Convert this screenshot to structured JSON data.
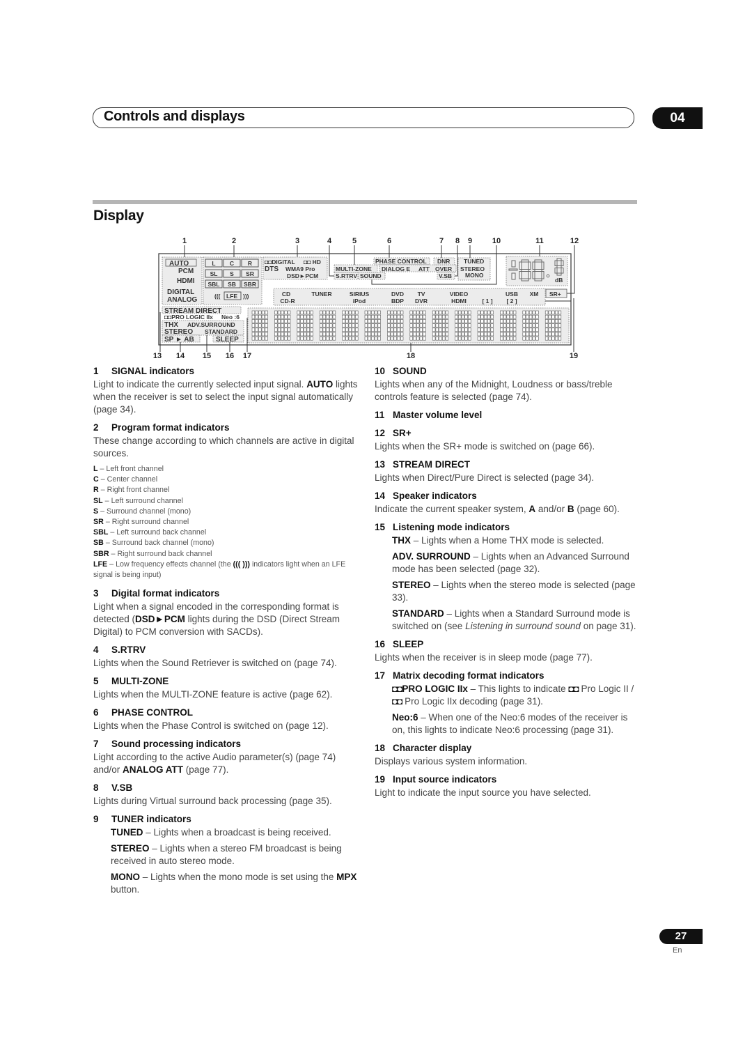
{
  "header": {
    "chapter_title": "Controls and displays",
    "chapter_number": "04"
  },
  "section": {
    "title": "Display"
  },
  "diagram": {
    "callouts_top": [
      "1",
      "2",
      "3",
      "4",
      "5",
      "6",
      "7",
      "8",
      "9",
      "10",
      "11",
      "12"
    ],
    "callouts_bottom": [
      "13",
      "14",
      "15",
      "16",
      "17",
      "18",
      "19"
    ],
    "signal": {
      "auto": "AUTO",
      "pcm": "PCM",
      "hdmi": "HDMI",
      "digital": "DIGITAL",
      "analog": "ANALOG"
    },
    "channels": [
      "L",
      "C",
      "R",
      "SL",
      "S",
      "SR",
      "SBL",
      "SB",
      "SBR"
    ],
    "lfe": {
      "left": "(((",
      "label": "LFE",
      "right": ")))"
    },
    "digital_format": {
      "dd_digital": "DIGITAL",
      "dd_hd": "HD",
      "dts": "DTS",
      "wma": "WMA9 Pro",
      "dsd": "DSD",
      "pcm": "PCM"
    },
    "multi_zone": "MULTI-ZONE",
    "s_rtrv": "S.RTRV",
    "sound": "SOUND",
    "phase_control": "PHASE CONTROL",
    "dialog_e": "DIALOG E",
    "att": "ATT",
    "over": "OVER",
    "dnr": "DNR",
    "vsb": "V.SB",
    "tuner": {
      "tuned": "TUNED",
      "stereo": "STEREO",
      "mono": "MONO"
    },
    "volume_unit": "dB",
    "inputs_row1": [
      "CD",
      "TUNER",
      "SIRIUS",
      "DVD",
      "TV",
      "VIDEO",
      "USB",
      "XM"
    ],
    "inputs_row2": [
      "CD-R",
      "iPod",
      "BDP",
      "DVR",
      "HDMI",
      "[ 1 ]",
      "[ 2 ]"
    ],
    "sr_plus": "SR+",
    "stream_direct": "STREAM DIRECT",
    "pro_logic": "PRO LOGIC",
    "pro_logic_suffix": "IIx",
    "neo": "Neo :6",
    "thx": "THX",
    "adv_surround": "ADV.SURROUND",
    "stereo": "STEREO",
    "standard": "STANDARD",
    "speaker": "SP ► AB",
    "sleep": "SLEEP",
    "character_cells": 14
  },
  "left_column": [
    {
      "num": "1",
      "title": "SIGNAL indicators",
      "body": [
        {
          "text": "Light to indicate the currently selected input signal. "
        },
        {
          "bold": "AUTO"
        },
        {
          "text": " lights when the receiver is set to select the input signal automatically (page 34)."
        }
      ]
    },
    {
      "num": "2",
      "title": "Program format indicators",
      "body": [
        {
          "text": "These change according to which channels are active in digital sources."
        }
      ],
      "legend": [
        {
          "key": "L",
          "desc": "Left front channel"
        },
        {
          "key": "C",
          "desc": "Center channel"
        },
        {
          "key": "R",
          "desc": "Right front channel"
        },
        {
          "key": "SL",
          "desc": "Left surround channel"
        },
        {
          "key": "S",
          "desc": "Surround channel (mono)"
        },
        {
          "key": "SR",
          "desc": "Right surround channel"
        },
        {
          "key": "SBL",
          "desc": "Left surround back channel"
        },
        {
          "key": "SB",
          "desc": "Surround back channel (mono)"
        },
        {
          "key": "SBR",
          "desc": "Right surround back channel"
        },
        {
          "key": "LFE",
          "desc": "Low frequency effects channel (the",
          "mid": "(((   )))",
          "tail": "indicators light when an LFE signal is being input)"
        }
      ]
    },
    {
      "num": "3",
      "title": "Digital format indicators",
      "body": [
        {
          "text": "Light when a signal encoded in the corresponding format is detected ("
        },
        {
          "bold": "DSD►PCM"
        },
        {
          "text": " lights during the DSD (Direct Stream Digital) to PCM conversion with SACDs)."
        }
      ]
    },
    {
      "num": "4",
      "title": "S.RTRV",
      "body": [
        {
          "text": "Lights when the Sound Retriever is switched on (page 74)."
        }
      ]
    },
    {
      "num": "5",
      "title": "MULTI-ZONE",
      "body": [
        {
          "text": "Lights when the MULTI-ZONE feature is active (page 62)."
        }
      ]
    },
    {
      "num": "6",
      "title": "PHASE CONTROL",
      "body": [
        {
          "text": "Lights when the Phase Control is switched on (page 12)."
        }
      ]
    },
    {
      "num": "7",
      "title": "Sound processing indicators",
      "body": [
        {
          "text": "Light according to the active Audio parameter(s) (page 74) and/or "
        },
        {
          "bold": "ANALOG ATT"
        },
        {
          "text": " (page 77)."
        }
      ]
    },
    {
      "num": "8",
      "title": "V.SB",
      "body": [
        {
          "text": "Lights during Virtual surround back processing (page 35)."
        }
      ]
    },
    {
      "num": "9",
      "title": "TUNER indicators",
      "subs": [
        [
          {
            "bold": "TUNED"
          },
          {
            "text": " – Lights when a broadcast is being received."
          }
        ],
        [
          {
            "bold": "STEREO"
          },
          {
            "text": " – Lights when a stereo FM broadcast is being received in auto stereo mode."
          }
        ],
        [
          {
            "bold": "MONO"
          },
          {
            "text": " – Lights when the mono mode is set using the "
          },
          {
            "bold": "MPX"
          },
          {
            "text": " button."
          }
        ]
      ]
    }
  ],
  "right_column": [
    {
      "num": "10",
      "title": "SOUND",
      "body": [
        {
          "text": "Lights when any of the Midnight, Loudness or bass/treble controls feature is selected (page 74)."
        }
      ]
    },
    {
      "num": "11",
      "title": "Master volume level",
      "body": []
    },
    {
      "num": "12",
      "title": "SR+",
      "body": [
        {
          "text": "Lights when the SR+ mode is switched on (page 66)."
        }
      ]
    },
    {
      "num": "13",
      "title": "STREAM DIRECT",
      "body": [
        {
          "text": "Lights when Direct/Pure Direct is selected (page 34)."
        }
      ]
    },
    {
      "num": "14",
      "title": "Speaker indicators",
      "body": [
        {
          "text": "Indicate the current speaker system, "
        },
        {
          "bold": "A"
        },
        {
          "text": " and/or "
        },
        {
          "bold": "B"
        },
        {
          "text": " (page 60)."
        }
      ]
    },
    {
      "num": "15",
      "title": "Listening mode indicators",
      "subs": [
        [
          {
            "bold": "THX"
          },
          {
            "text": " – Lights when a Home THX mode is selected."
          }
        ],
        [
          {
            "bold": "ADV. SURROUND"
          },
          {
            "text": " – Lights when an Advanced Surround mode has been selected (page 32)."
          }
        ],
        [
          {
            "bold": "STEREO"
          },
          {
            "text": " – Lights when the stereo mode is selected (page 33)."
          }
        ],
        [
          {
            "bold": "STANDARD"
          },
          {
            "text": " – Lights when a Standard Surround mode is switched on (see "
          },
          {
            "italic": "Listening in surround sound"
          },
          {
            "text": " on page 31)."
          }
        ]
      ]
    },
    {
      "num": "16",
      "title": "SLEEP",
      "body": [
        {
          "text": "Lights when the receiver is in sleep mode (page 77)."
        }
      ]
    },
    {
      "num": "17",
      "title": "Matrix decoding format indicators",
      "subs": [
        [
          {
            "dd": "DD"
          },
          {
            "bold": "PRO LOGIC IIx"
          },
          {
            "text": " – This lights to indicate "
          },
          {
            "dd": "DD"
          },
          {
            "text": " Pro Logic II / "
          },
          {
            "dd": "DD"
          },
          {
            "text": " Pro Logic IIx decoding (page 31)."
          }
        ],
        [
          {
            "bold": "Neo:6"
          },
          {
            "text": " – When one of the Neo:6 modes of the receiver is on, this lights to indicate Neo:6 processing (page 31)."
          }
        ]
      ]
    },
    {
      "num": "18",
      "title": "Character display",
      "body": [
        {
          "text": "Displays various system information."
        }
      ]
    },
    {
      "num": "19",
      "title": "Input source indicators",
      "body": [
        {
          "text": "Light to indicate the input source you have selected."
        }
      ]
    }
  ],
  "footer": {
    "page_number": "27",
    "language": "En"
  }
}
